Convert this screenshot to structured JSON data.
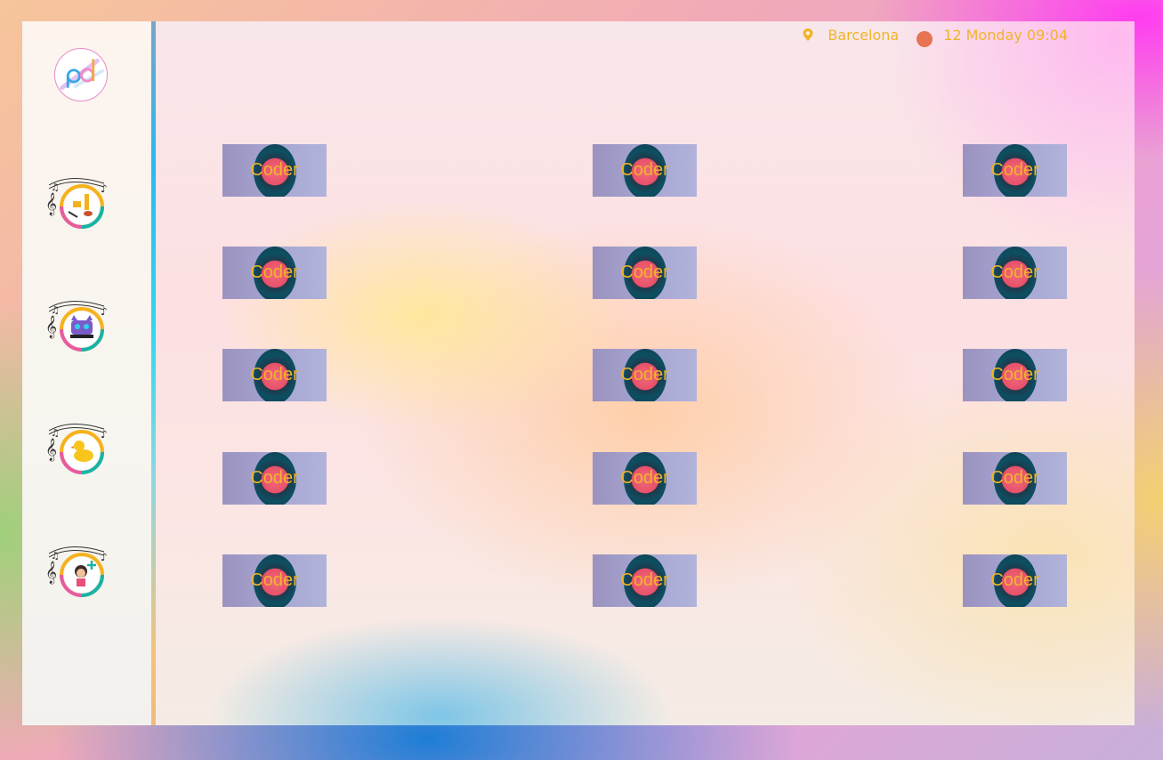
{
  "header": {
    "location_icon": "location-pin-icon",
    "location": "Barcelona",
    "status_dot_color": "#e67452",
    "datetime": "12 Monday 09:04"
  },
  "sidebar": {
    "logo": {
      "text": "pd",
      "icon": "app-logo"
    },
    "items": [
      {
        "name": "instruments",
        "icon": "music-instruments-icon"
      },
      {
        "name": "cat",
        "icon": "cat-icon"
      },
      {
        "name": "duck",
        "icon": "rubber-duck-icon"
      },
      {
        "name": "add-kid",
        "icon": "add-kid-icon"
      }
    ]
  },
  "grid": {
    "tiles": [
      {
        "label": "Coder"
      },
      {
        "label": "Coder"
      },
      {
        "label": "Coder"
      },
      {
        "label": "Coder"
      },
      {
        "label": "Coder"
      },
      {
        "label": "Coder"
      },
      {
        "label": "Coder"
      },
      {
        "label": "Coder"
      },
      {
        "label": "Coder"
      },
      {
        "label": "Coder"
      },
      {
        "label": "Coder"
      },
      {
        "label": "Coder"
      },
      {
        "label": "Coder"
      },
      {
        "label": "Coder"
      },
      {
        "label": "Coder"
      }
    ]
  },
  "colors": {
    "accent": "#f0b429",
    "dot": "#e67452"
  }
}
